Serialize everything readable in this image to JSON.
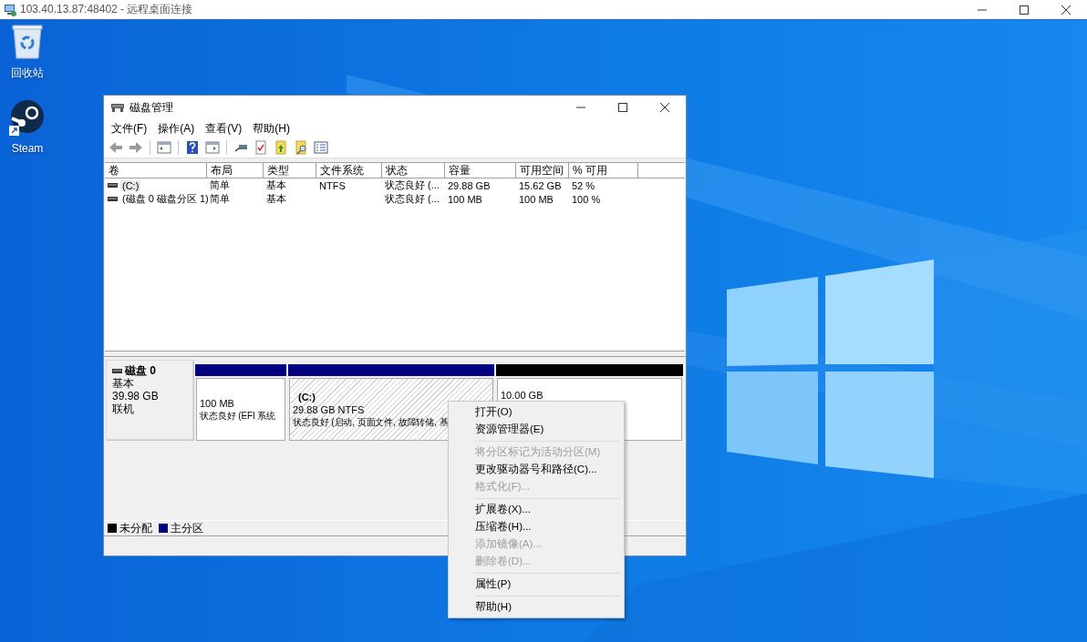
{
  "rdp_window": {
    "title": "103.40.13.87:48402 - 远程桌面连接"
  },
  "desktop_icons": [
    {
      "kind": "recycle",
      "label": "回收站"
    },
    {
      "kind": "steam",
      "label": "Steam"
    }
  ],
  "disk_window": {
    "title": "磁盘管理",
    "menu": [
      "文件(F)",
      "操作(A)",
      "查看(V)",
      "帮助(H)"
    ],
    "table": {
      "columns": [
        "卷",
        "布局",
        "类型",
        "文件系统",
        "状态",
        "容量",
        "可用空间",
        "% 可用"
      ],
      "rows": [
        {
          "selected": true,
          "cells": [
            "(C:)",
            "简单",
            "基本",
            "NTFS",
            "状态良好 (...",
            "29.88 GB",
            "15.62 GB",
            "52 %"
          ]
        },
        {
          "selected": false,
          "cells": [
            "(磁盘 0 磁盘分区 1)",
            "简单",
            "基本",
            null,
            "状态良好 (...",
            "100 MB",
            "100 MB",
            "100 %"
          ]
        }
      ]
    },
    "disks": [
      {
        "name": "磁盘 0",
        "type": "基本",
        "size": "39.98 GB",
        "status": "联机",
        "partitions": [
          {
            "kind": "primary",
            "selected": false,
            "size": "100 MB",
            "status": "状态良好 (EFI 系统"
          },
          {
            "kind": "primary",
            "selected": true,
            "label": "(C:)",
            "size": "29.88 GB NTFS",
            "status": "状态良好 (启动, 页面文件, 故障转储, 基"
          },
          {
            "kind": "unallocated",
            "selected": false,
            "size": "10.00 GB"
          }
        ]
      }
    ],
    "legend": [
      {
        "label": "未分配",
        "color": "#000000"
      },
      {
        "label": "主分区",
        "color": "#000080"
      }
    ]
  },
  "context_menu": [
    {
      "kind": "item",
      "label": "打开(O)",
      "disabled": false
    },
    {
      "kind": "item",
      "label": "资源管理器(E)",
      "disabled": false
    },
    {
      "kind": "separator"
    },
    {
      "kind": "item",
      "label": "将分区标记为活动分区(M)",
      "disabled": true
    },
    {
      "kind": "item",
      "label": "更改驱动器号和路径(C)...",
      "disabled": false
    },
    {
      "kind": "item",
      "label": "格式化(F)...",
      "disabled": true
    },
    {
      "kind": "separator"
    },
    {
      "kind": "item",
      "label": "扩展卷(X)...",
      "disabled": false
    },
    {
      "kind": "item",
      "label": "压缩卷(H)...",
      "disabled": false
    },
    {
      "kind": "item",
      "label": "添加镜像(A)...",
      "disabled": true
    },
    {
      "kind": "item",
      "label": "删除卷(D)...",
      "disabled": true
    },
    {
      "kind": "separator"
    },
    {
      "kind": "item",
      "label": "属性(P)",
      "disabled": false
    },
    {
      "kind": "separator"
    },
    {
      "kind": "item",
      "label": "帮助(H)",
      "disabled": false
    }
  ]
}
